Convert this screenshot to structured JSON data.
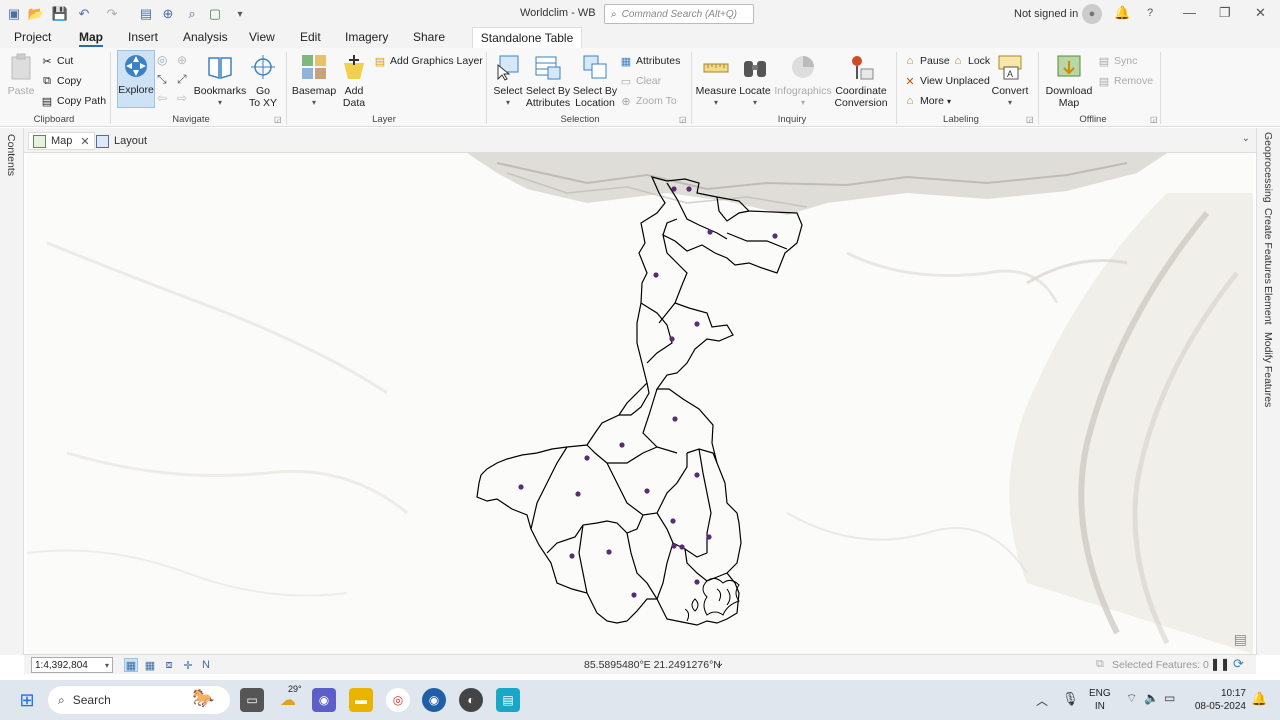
{
  "window": {
    "title": "Worldclim - WB",
    "search_placeholder": "Command Search (Alt+Q)",
    "signin": "Not signed in",
    "help": "?"
  },
  "ribbon_tabs": [
    "Project",
    "Map",
    "Insert",
    "Analysis",
    "View",
    "Edit",
    "Imagery",
    "Share"
  ],
  "contextual_tab": "Standalone Table",
  "ribbon": {
    "clipboard": {
      "label": "Clipboard",
      "paste": "Paste",
      "cut": "Cut",
      "copy": "Copy",
      "copy_path": "Copy Path"
    },
    "navigate": {
      "label": "Navigate",
      "explore": "Explore",
      "bookmarks": "Bookmarks",
      "go_to_xy_1": "Go",
      "go_to_xy_2": "To XY"
    },
    "layer": {
      "label": "Layer",
      "basemap": "Basemap",
      "add_data_1": "Add",
      "add_data_2": "Data",
      "add_graphics": "Add Graphics Layer"
    },
    "selection": {
      "label": "Selection",
      "select": "Select",
      "by_attr_1": "Select By",
      "by_attr_2": "Attributes",
      "by_loc_1": "Select By",
      "by_loc_2": "Location",
      "attributes": "Attributes",
      "clear": "Clear",
      "zoom_to": "Zoom To"
    },
    "inquiry": {
      "label": "Inquiry",
      "measure": "Measure",
      "locate": "Locate",
      "infographics": "Infographics",
      "coord_1": "Coordinate",
      "coord_2": "Conversion"
    },
    "labeling": {
      "label": "Labeling",
      "pause": "Pause",
      "lock": "Lock",
      "view_unplaced": "View Unplaced",
      "more": "More",
      "convert": "Convert"
    },
    "offline": {
      "label": "Offline",
      "download_1": "Download",
      "download_2": "Map",
      "sync": "Sync",
      "remove": "Remove"
    }
  },
  "view_tabs": {
    "map": "Map",
    "layout": "Layout"
  },
  "left_pane": {
    "contents": "Contents"
  },
  "right_pane": [
    "Geoprocessing",
    "Create Features",
    "Element",
    "Modify Features"
  ],
  "status": {
    "scale": "1:4,392,804",
    "coords": "85.5895480°E 21.2491276°N",
    "selected_features": "Selected Features: 0"
  },
  "taskbar": {
    "search": "Search",
    "weather_temp": "29°",
    "lang_1": "ENG",
    "lang_2": "IN",
    "time": "10:17",
    "date": "08-05-2024"
  },
  "colors": {
    "accent": "#2b6cb0",
    "point": "#5b2b78",
    "boundary": "#000000"
  }
}
